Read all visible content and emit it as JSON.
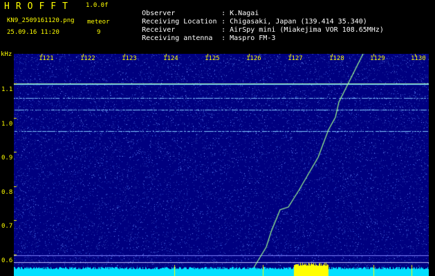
{
  "header": {
    "logo": "HROFFT",
    "version": "1.0.0f",
    "file_name": "KN9_2509161120.png",
    "date_time": "25.09.16 11:20",
    "meteor_label": "meteor",
    "meteor_count": "9"
  },
  "info": [
    {
      "key": "Observer",
      "value": ": K.Nagai"
    },
    {
      "key": "Receiving Location",
      "value": ": Chigasaki, Japan (139.414 35.340)"
    },
    {
      "key": "Receiver",
      "value": ": AirSpy mini (Miakejima VOR 108.65MHz)"
    },
    {
      "key": "Receiving antenna",
      "value": ": Maspro FM-3"
    }
  ],
  "plot": {
    "y_unit": "kHz",
    "y_ticks": [
      "1.1",
      "1.0",
      "0.9",
      "0.8",
      "0.7",
      "0.6"
    ],
    "x_ticks": [
      "1121",
      "1122",
      "1123",
      "1124",
      "1125",
      "1126",
      "1127",
      "1128",
      "1129",
      "1130"
    ],
    "colors": {
      "background": "#000080",
      "noise": "#3050d0",
      "trace": "#a0ff90",
      "tick": "#ffff00",
      "baseline": "#00e0ff"
    }
  }
}
